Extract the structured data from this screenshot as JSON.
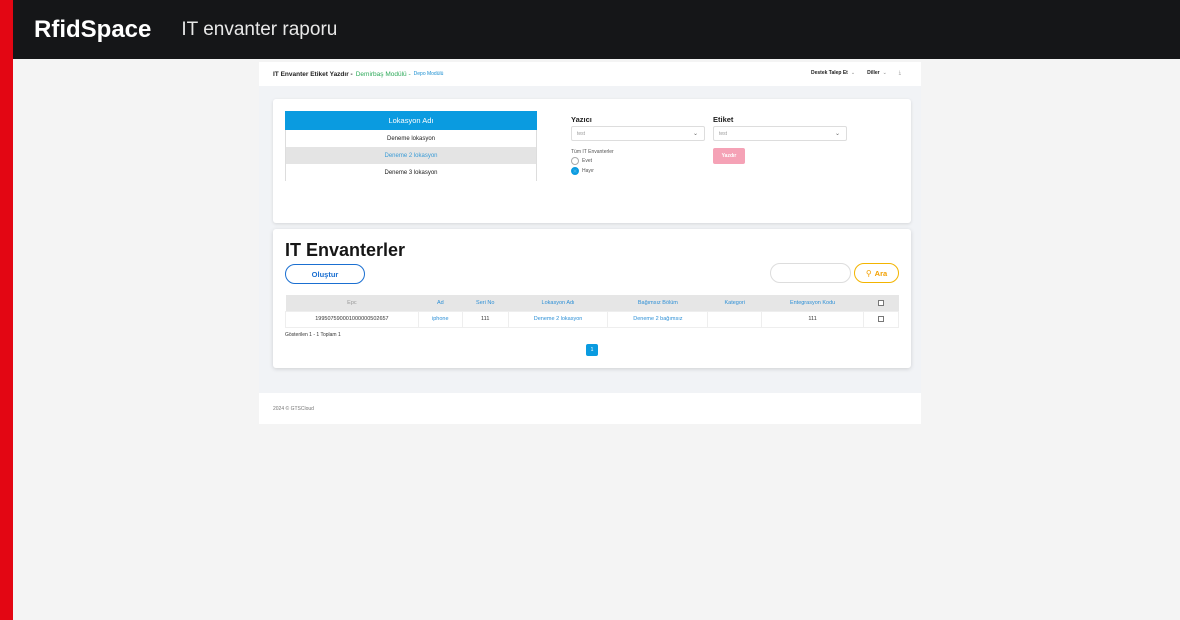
{
  "window": {
    "brand": "RfidSpace",
    "subtitle": "IT envanter raporu"
  },
  "colors": {
    "accent_red": "#e30613",
    "primary_blue": "#0a9be0",
    "green": "#2eaa5a",
    "pink_button": "#f5a2b6",
    "search_yellow": "#f3b400"
  },
  "header": {
    "title": "IT Envanter Etiket Yazdır -",
    "module_green": "Demirbaş Modülü -",
    "module_blue": "Depo Modülü",
    "support": "Destek Talep Et",
    "languages": "Diller",
    "download_icon": "download-icon"
  },
  "locations": {
    "header": "Lokasyon Adı",
    "rows": [
      "Deneme lokasyon",
      "Deneme 2 lokasyon",
      "Deneme 3 lokasyon"
    ],
    "selected": "Deneme 2 lokasyon"
  },
  "printer": {
    "label": "Yazıcı",
    "value": "test"
  },
  "label_field": {
    "label": "Etiket",
    "value": "test"
  },
  "all_it": {
    "label": "Tüm IT Envanterler",
    "options": [
      "Evet",
      "Hayır"
    ],
    "selected": "Hayır"
  },
  "print_button": "Yazdır",
  "inventory": {
    "title": "IT Envanterler",
    "create_button": "Oluştur",
    "search_value": "",
    "search_button": "Ara",
    "columns": [
      "Epc",
      "Ad",
      "Seri No",
      "Lokasyon Adı",
      "Bağımsız Bölüm",
      "Kategori",
      "Entegrasyon Kodu"
    ],
    "rows": [
      {
        "epc": "199507590001000000502657",
        "ad": "iphone",
        "seri_no": "111",
        "lokasyon": "Deneme 2 lokasyon",
        "bolum": "Deneme 2 bağımsız",
        "kategori": "",
        "entegrasyon": "111"
      }
    ],
    "showing": "Gösterilen 1 - 1 Toplam 1",
    "page": "1"
  },
  "footer": "2024 © GTSCloud"
}
